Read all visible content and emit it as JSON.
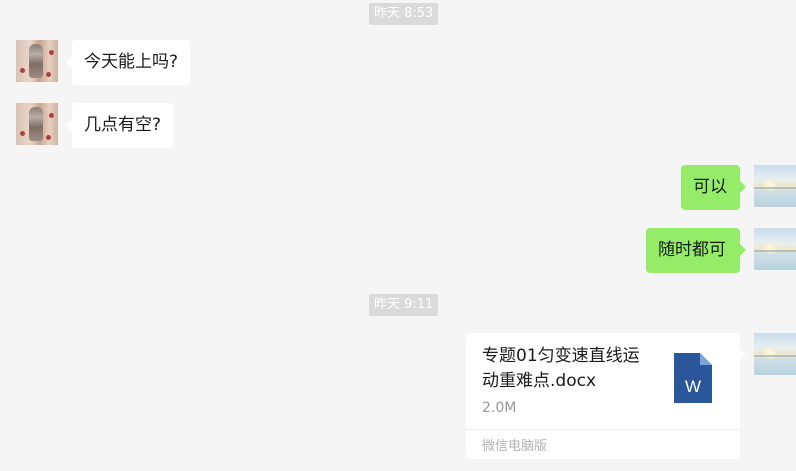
{
  "timestamps": [
    "昨天 8:53",
    "昨天 9:11"
  ],
  "messages": {
    "m1": "今天能上吗?",
    "m2": "几点有空?",
    "m3": "可以",
    "m4": "随时都可"
  },
  "file": {
    "name": "专题01匀变速直线运动重难点.docx",
    "size": "2.0M",
    "source": "微信电脑版",
    "icon_letter": "W",
    "icon_color": "#2b579a"
  },
  "colors": {
    "outgoing_bubble": "#95ec69",
    "incoming_bubble": "#ffffff",
    "background": "#f5f5f5"
  },
  "icons": {
    "friend_avatar": "friend-avatar",
    "self_avatar": "self-avatar",
    "file_type": "word-doc-icon"
  }
}
